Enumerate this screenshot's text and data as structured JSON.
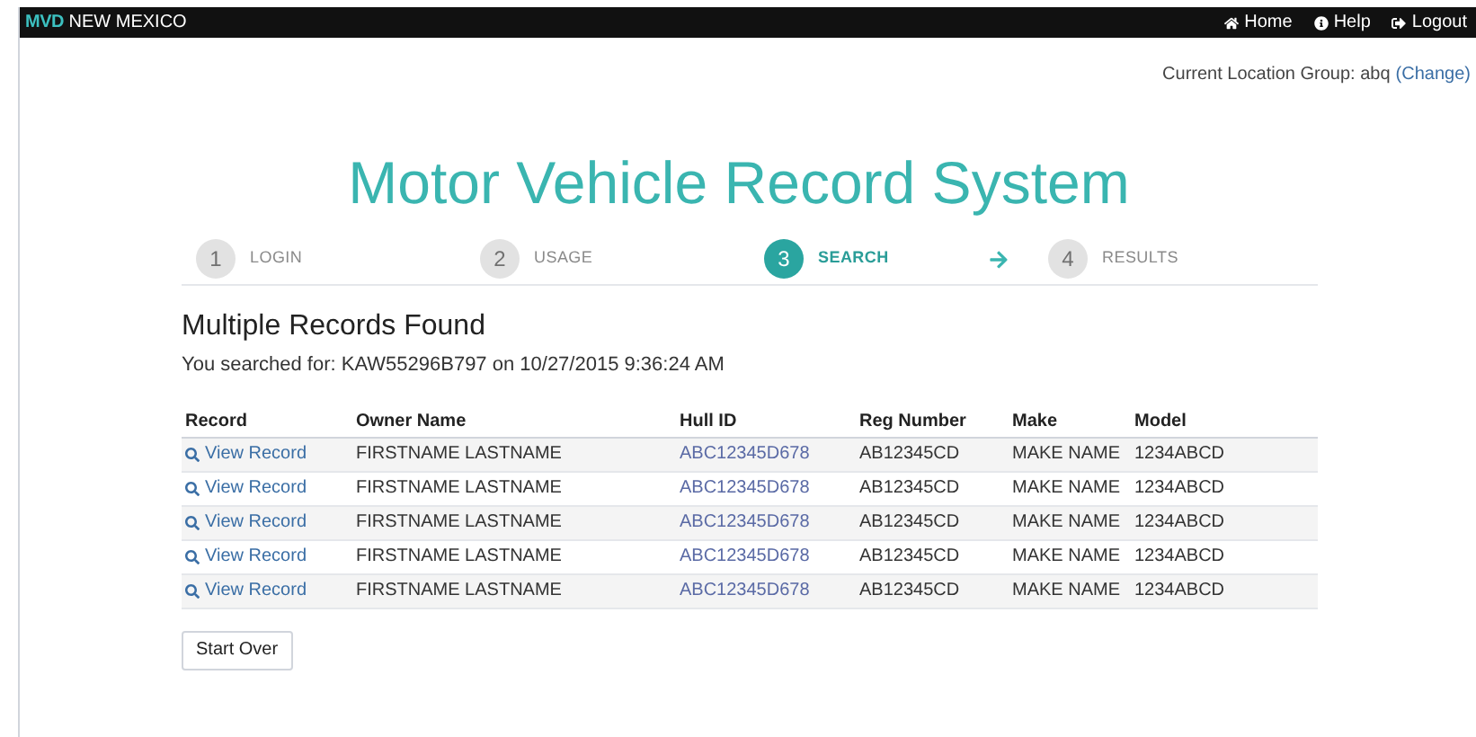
{
  "navbar": {
    "logo_mark": "MVD",
    "logo_text": "NEW MEXICO",
    "links": [
      {
        "kind": "home",
        "label": "Home"
      },
      {
        "kind": "help",
        "label": "Help"
      },
      {
        "kind": "logout",
        "label": "Logout"
      }
    ]
  },
  "location": {
    "label": "Current Location Group: abq",
    "link": "(Change)"
  },
  "title": "Motor Vehicle Record System",
  "steps": [
    {
      "number": "1",
      "label": "LOGIN",
      "selected": false
    },
    {
      "number": "2",
      "label": "USAGE",
      "selected": false
    },
    {
      "number": "3",
      "label": "SEARCH",
      "selected": true
    },
    {
      "number": "4",
      "label": "RESULTS",
      "selected": false
    }
  ],
  "heading": "Multiple Records Found",
  "searched": "You searched for: KAW55296B797 on 10/27/2015 9:36:24 AM",
  "table": {
    "columns": [
      "Record",
      "Owner Name",
      "Hull ID",
      "Reg Number",
      "Make",
      "Model"
    ],
    "rows": [
      {
        "record": "View Record",
        "owner": "FIRSTNAME LASTNAME",
        "hull_id": "ABC12345D678",
        "reg": "AB12345CD",
        "make": "MAKE NAME",
        "model": "1234ABCD"
      },
      {
        "record": "View Record",
        "owner": "FIRSTNAME LASTNAME",
        "hull_id": "ABC12345D678",
        "reg": "AB12345CD",
        "make": "MAKE NAME",
        "model": "1234ABCD"
      },
      {
        "record": "View Record",
        "owner": "FIRSTNAME LASTNAME",
        "hull_id": "ABC12345D678",
        "reg": "AB12345CD",
        "make": "MAKE NAME",
        "model": "1234ABCD"
      },
      {
        "record": "View Record",
        "owner": "FIRSTNAME LASTNAME",
        "hull_id": "ABC12345D678",
        "reg": "AB12345CD",
        "make": "MAKE NAME",
        "model": "1234ABCD"
      },
      {
        "record": "View Record",
        "owner": "FIRSTNAME LASTNAME",
        "hull_id": "ABC12345D678",
        "reg": "AB12345CD",
        "make": "MAKE NAME",
        "model": "1234ABCD"
      }
    ]
  },
  "button": "Start Over"
}
